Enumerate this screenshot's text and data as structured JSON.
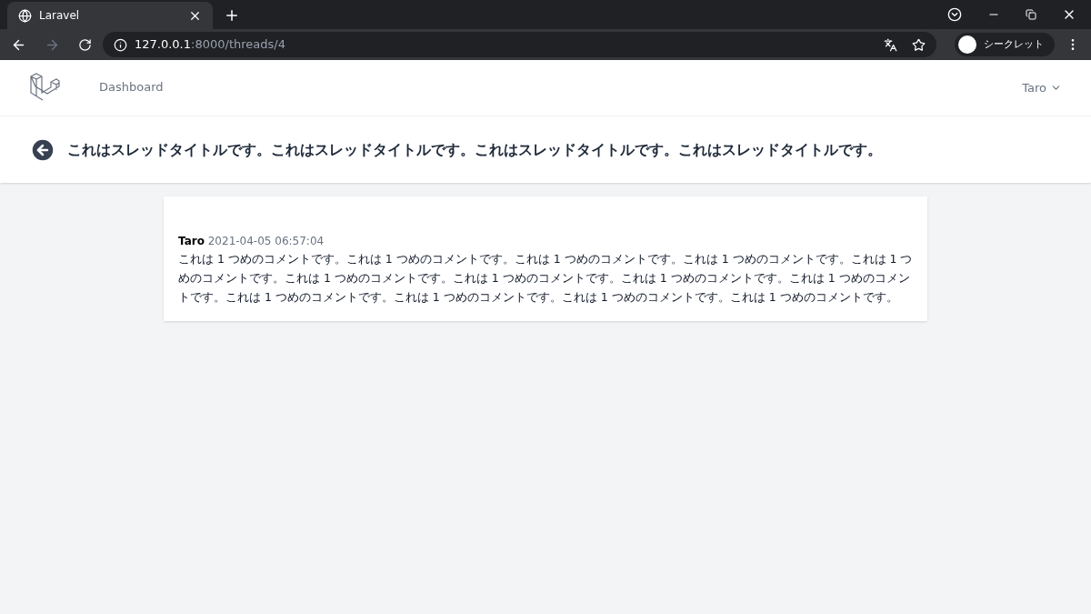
{
  "browser": {
    "tab_title": "Laravel",
    "url_host": "127.0.0.1",
    "url_path": ":8000/threads/4",
    "profile_label": "シークレット"
  },
  "nav": {
    "links": [
      {
        "label": "Dashboard",
        "selected": false
      }
    ],
    "user": "Taro"
  },
  "header": {
    "title": "これはスレッドタイトルです。これはスレッドタイトルです。これはスレッドタイトルです。これはスレッドタイトルです。"
  },
  "comments": [
    {
      "author": "Taro",
      "time": "2021-04-05 06:57:04",
      "body": "これは 1 つめのコメントです。これは 1 つめのコメントです。これは 1 つめのコメントです。これは 1 つめのコメントです。これは 1 つめのコメントです。これは 1 つめのコメントです。これは 1 つめのコメントです。これは 1 つめのコメントです。これは 1 つめのコメントです。これは 1 つめのコメントです。これは 1 つめのコメントです。これは 1 つめのコメントです。これは 1 つめのコメントです。"
    }
  ]
}
